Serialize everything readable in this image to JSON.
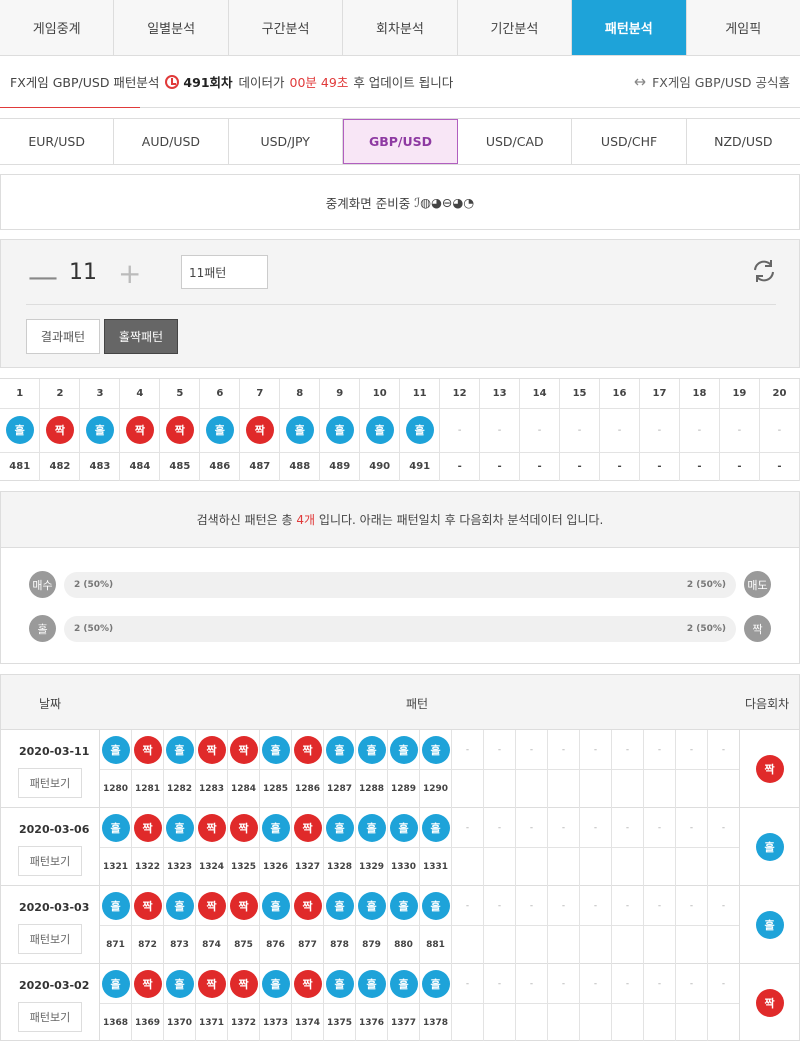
{
  "nav": {
    "tabs": [
      "게임중계",
      "일별분석",
      "구간분석",
      "회차분석",
      "기간분석",
      "패턴분석",
      "게임픽"
    ],
    "active": 5
  },
  "info": {
    "prefix": "FX게임 GBP/USD 패턴분석",
    "round": "491회차",
    "data_label": "데이터가",
    "timer": "00분 49초",
    "suffix": "후 업데이트 됩니다",
    "official": "FX게임 GBP/USD 공식홈"
  },
  "currencies": {
    "items": [
      "EUR/USD",
      "AUD/USD",
      "USD/JPY",
      "GBP/USD",
      "USD/CAD",
      "USD/CHF",
      "NZD/USD"
    ],
    "active": 3
  },
  "status": {
    "text": "중계화면 준비중",
    "loading_glyph": "ℐ◍◕⊖◕◔"
  },
  "control": {
    "count": "11",
    "count_box": "11패턴",
    "btn_result": "결과패턴",
    "btn_oddeven": "홀짝패턴"
  },
  "grid": {
    "cols": [
      "1",
      "2",
      "3",
      "4",
      "5",
      "6",
      "7",
      "8",
      "9",
      "10",
      "11",
      "12",
      "13",
      "14",
      "15",
      "16",
      "17",
      "18",
      "19",
      "20"
    ],
    "balls": [
      "홀",
      "짝",
      "홀",
      "짝",
      "짝",
      "홀",
      "짝",
      "홀",
      "홀",
      "홀",
      "홀"
    ],
    "rounds": [
      "481",
      "482",
      "483",
      "484",
      "485",
      "486",
      "487",
      "488",
      "489",
      "490",
      "491"
    ],
    "dash": "-"
  },
  "summary": {
    "pre": "검색하신 패턴은 총",
    "count": "4개",
    "post": "입니다. 아래는 패턴일치 후 다음회차 분석데이터 입니다.",
    "row1": {
      "left_label": "매수",
      "left_val": "2 (50%)",
      "right_val": "2 (50%)",
      "right_label": "매도"
    },
    "row2": {
      "left_label": "홀",
      "left_val": "2 (50%)",
      "right_val": "2 (50%)",
      "right_label": "짝"
    }
  },
  "history": {
    "headers": {
      "date": "날짜",
      "pattern": "패턴",
      "next": "다음회차"
    },
    "view_label": "패턴보기",
    "rows": [
      {
        "date": "2020-03-11",
        "balls": [
          "홀",
          "짝",
          "홀",
          "짝",
          "짝",
          "홀",
          "짝",
          "홀",
          "홀",
          "홀",
          "홀"
        ],
        "rounds": [
          "1280",
          "1281",
          "1282",
          "1283",
          "1284",
          "1285",
          "1286",
          "1287",
          "1288",
          "1289",
          "1290"
        ],
        "next": "짝"
      },
      {
        "date": "2020-03-06",
        "balls": [
          "홀",
          "짝",
          "홀",
          "짝",
          "짝",
          "홀",
          "짝",
          "홀",
          "홀",
          "홀",
          "홀"
        ],
        "rounds": [
          "1321",
          "1322",
          "1323",
          "1324",
          "1325",
          "1326",
          "1327",
          "1328",
          "1329",
          "1330",
          "1331"
        ],
        "next": "홀"
      },
      {
        "date": "2020-03-03",
        "balls": [
          "홀",
          "짝",
          "홀",
          "짝",
          "짝",
          "홀",
          "짝",
          "홀",
          "홀",
          "홀",
          "홀"
        ],
        "rounds": [
          "871",
          "872",
          "873",
          "874",
          "875",
          "876",
          "877",
          "878",
          "879",
          "880",
          "881"
        ],
        "next": "홀"
      },
      {
        "date": "2020-03-02",
        "balls": [
          "홀",
          "짝",
          "홀",
          "짝",
          "짝",
          "홀",
          "짝",
          "홀",
          "홀",
          "홀",
          "홀"
        ],
        "rounds": [
          "1368",
          "1369",
          "1370",
          "1371",
          "1372",
          "1373",
          "1374",
          "1375",
          "1376",
          "1377",
          "1378"
        ],
        "next": "짝"
      }
    ]
  },
  "colors": {
    "odd": "#1ea3d9",
    "even": "#e02a2a",
    "accent": "#1ea3d9",
    "alert": "#e03a3a"
  }
}
